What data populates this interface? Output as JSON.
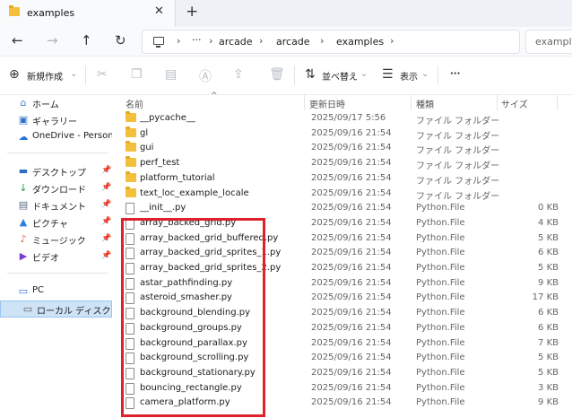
{
  "tab": {
    "title": "examples",
    "close": "✕",
    "new_tab": "+"
  },
  "nav": {
    "back": "←",
    "forward": "→",
    "up": "↑",
    "refresh": "↻",
    "ellipsis": "···",
    "breadcrumbs": [
      "arcade",
      "arcade",
      "examples"
    ],
    "search_text": "example"
  },
  "toolbar": {
    "new_label": "新規作成",
    "sort_label": "並べ替え",
    "view_label": "表示",
    "more": "···"
  },
  "sidebar": {
    "top": [
      {
        "label": "ホーム",
        "icon": "home-icon"
      },
      {
        "label": "ギャラリー",
        "icon": "gallery-icon"
      },
      {
        "label": "OneDrive - Personal",
        "icon": "cloud-icon"
      }
    ],
    "quick": [
      {
        "label": "デスクトップ",
        "icon": "desktop-icon"
      },
      {
        "label": "ダウンロード",
        "icon": "download-icon"
      },
      {
        "label": "ドキュメント",
        "icon": "document-icon"
      },
      {
        "label": "ピクチャ",
        "icon": "pictures-icon"
      },
      {
        "label": "ミュージック",
        "icon": "music-icon"
      },
      {
        "label": "ビデオ",
        "icon": "video-icon"
      }
    ],
    "pc": {
      "label": "PC",
      "icon": "pc-icon"
    },
    "drive": {
      "label": "ローカル ディスク (C:)",
      "icon": "drive-icon"
    }
  },
  "columns": {
    "name": "名前",
    "date": "更新日時",
    "type": "種類",
    "size": "サイズ"
  },
  "files": [
    {
      "name": "__pycache__",
      "date": "2025/09/17 5:56",
      "type": "ファイル フォルダー",
      "size": "",
      "kind": "folder"
    },
    {
      "name": "gl",
      "date": "2025/09/16 21:54",
      "type": "ファイル フォルダー",
      "size": "",
      "kind": "folder"
    },
    {
      "name": "gui",
      "date": "2025/09/16 21:54",
      "type": "ファイル フォルダー",
      "size": "",
      "kind": "folder"
    },
    {
      "name": "perf_test",
      "date": "2025/09/16 21:54",
      "type": "ファイル フォルダー",
      "size": "",
      "kind": "folder"
    },
    {
      "name": "platform_tutorial",
      "date": "2025/09/16 21:54",
      "type": "ファイル フォルダー",
      "size": "",
      "kind": "folder"
    },
    {
      "name": "text_loc_example_locale",
      "date": "2025/09/16 21:54",
      "type": "ファイル フォルダー",
      "size": "",
      "kind": "folder"
    },
    {
      "name": "__init__.py",
      "date": "2025/09/16 21:54",
      "type": "Python.File",
      "size": "0 KB",
      "kind": "file"
    },
    {
      "name": "array_backed_grid.py",
      "date": "2025/09/16 21:54",
      "type": "Python.File",
      "size": "4 KB",
      "kind": "file"
    },
    {
      "name": "array_backed_grid_buffered.py",
      "date": "2025/09/16 21:54",
      "type": "Python.File",
      "size": "5 KB",
      "kind": "file"
    },
    {
      "name": "array_backed_grid_sprites_1.py",
      "date": "2025/09/16 21:54",
      "type": "Python.File",
      "size": "6 KB",
      "kind": "file"
    },
    {
      "name": "array_backed_grid_sprites_2.py",
      "date": "2025/09/16 21:54",
      "type": "Python.File",
      "size": "5 KB",
      "kind": "file"
    },
    {
      "name": "astar_pathfinding.py",
      "date": "2025/09/16 21:54",
      "type": "Python.File",
      "size": "9 KB",
      "kind": "file"
    },
    {
      "name": "asteroid_smasher.py",
      "date": "2025/09/16 21:54",
      "type": "Python.File",
      "size": "17 KB",
      "kind": "file"
    },
    {
      "name": "background_blending.py",
      "date": "2025/09/16 21:54",
      "type": "Python.File",
      "size": "6 KB",
      "kind": "file"
    },
    {
      "name": "background_groups.py",
      "date": "2025/09/16 21:54",
      "type": "Python.File",
      "size": "6 KB",
      "kind": "file"
    },
    {
      "name": "background_parallax.py",
      "date": "2025/09/16 21:54",
      "type": "Python.File",
      "size": "7 KB",
      "kind": "file"
    },
    {
      "name": "background_scrolling.py",
      "date": "2025/09/16 21:54",
      "type": "Python.File",
      "size": "5 KB",
      "kind": "file"
    },
    {
      "name": "background_stationary.py",
      "date": "2025/09/16 21:54",
      "type": "Python.File",
      "size": "5 KB",
      "kind": "file"
    },
    {
      "name": "bouncing_rectangle.py",
      "date": "2025/09/16 21:54",
      "type": "Python.File",
      "size": "3 KB",
      "kind": "file"
    },
    {
      "name": "camera_platform.py",
      "date": "2025/09/16 21:54",
      "type": "Python.File",
      "size": "9 KB",
      "kind": "file"
    }
  ],
  "colors": {
    "highlight": "#e0202a",
    "folder": "#f3c03c",
    "selected": "#cfe3f7"
  }
}
